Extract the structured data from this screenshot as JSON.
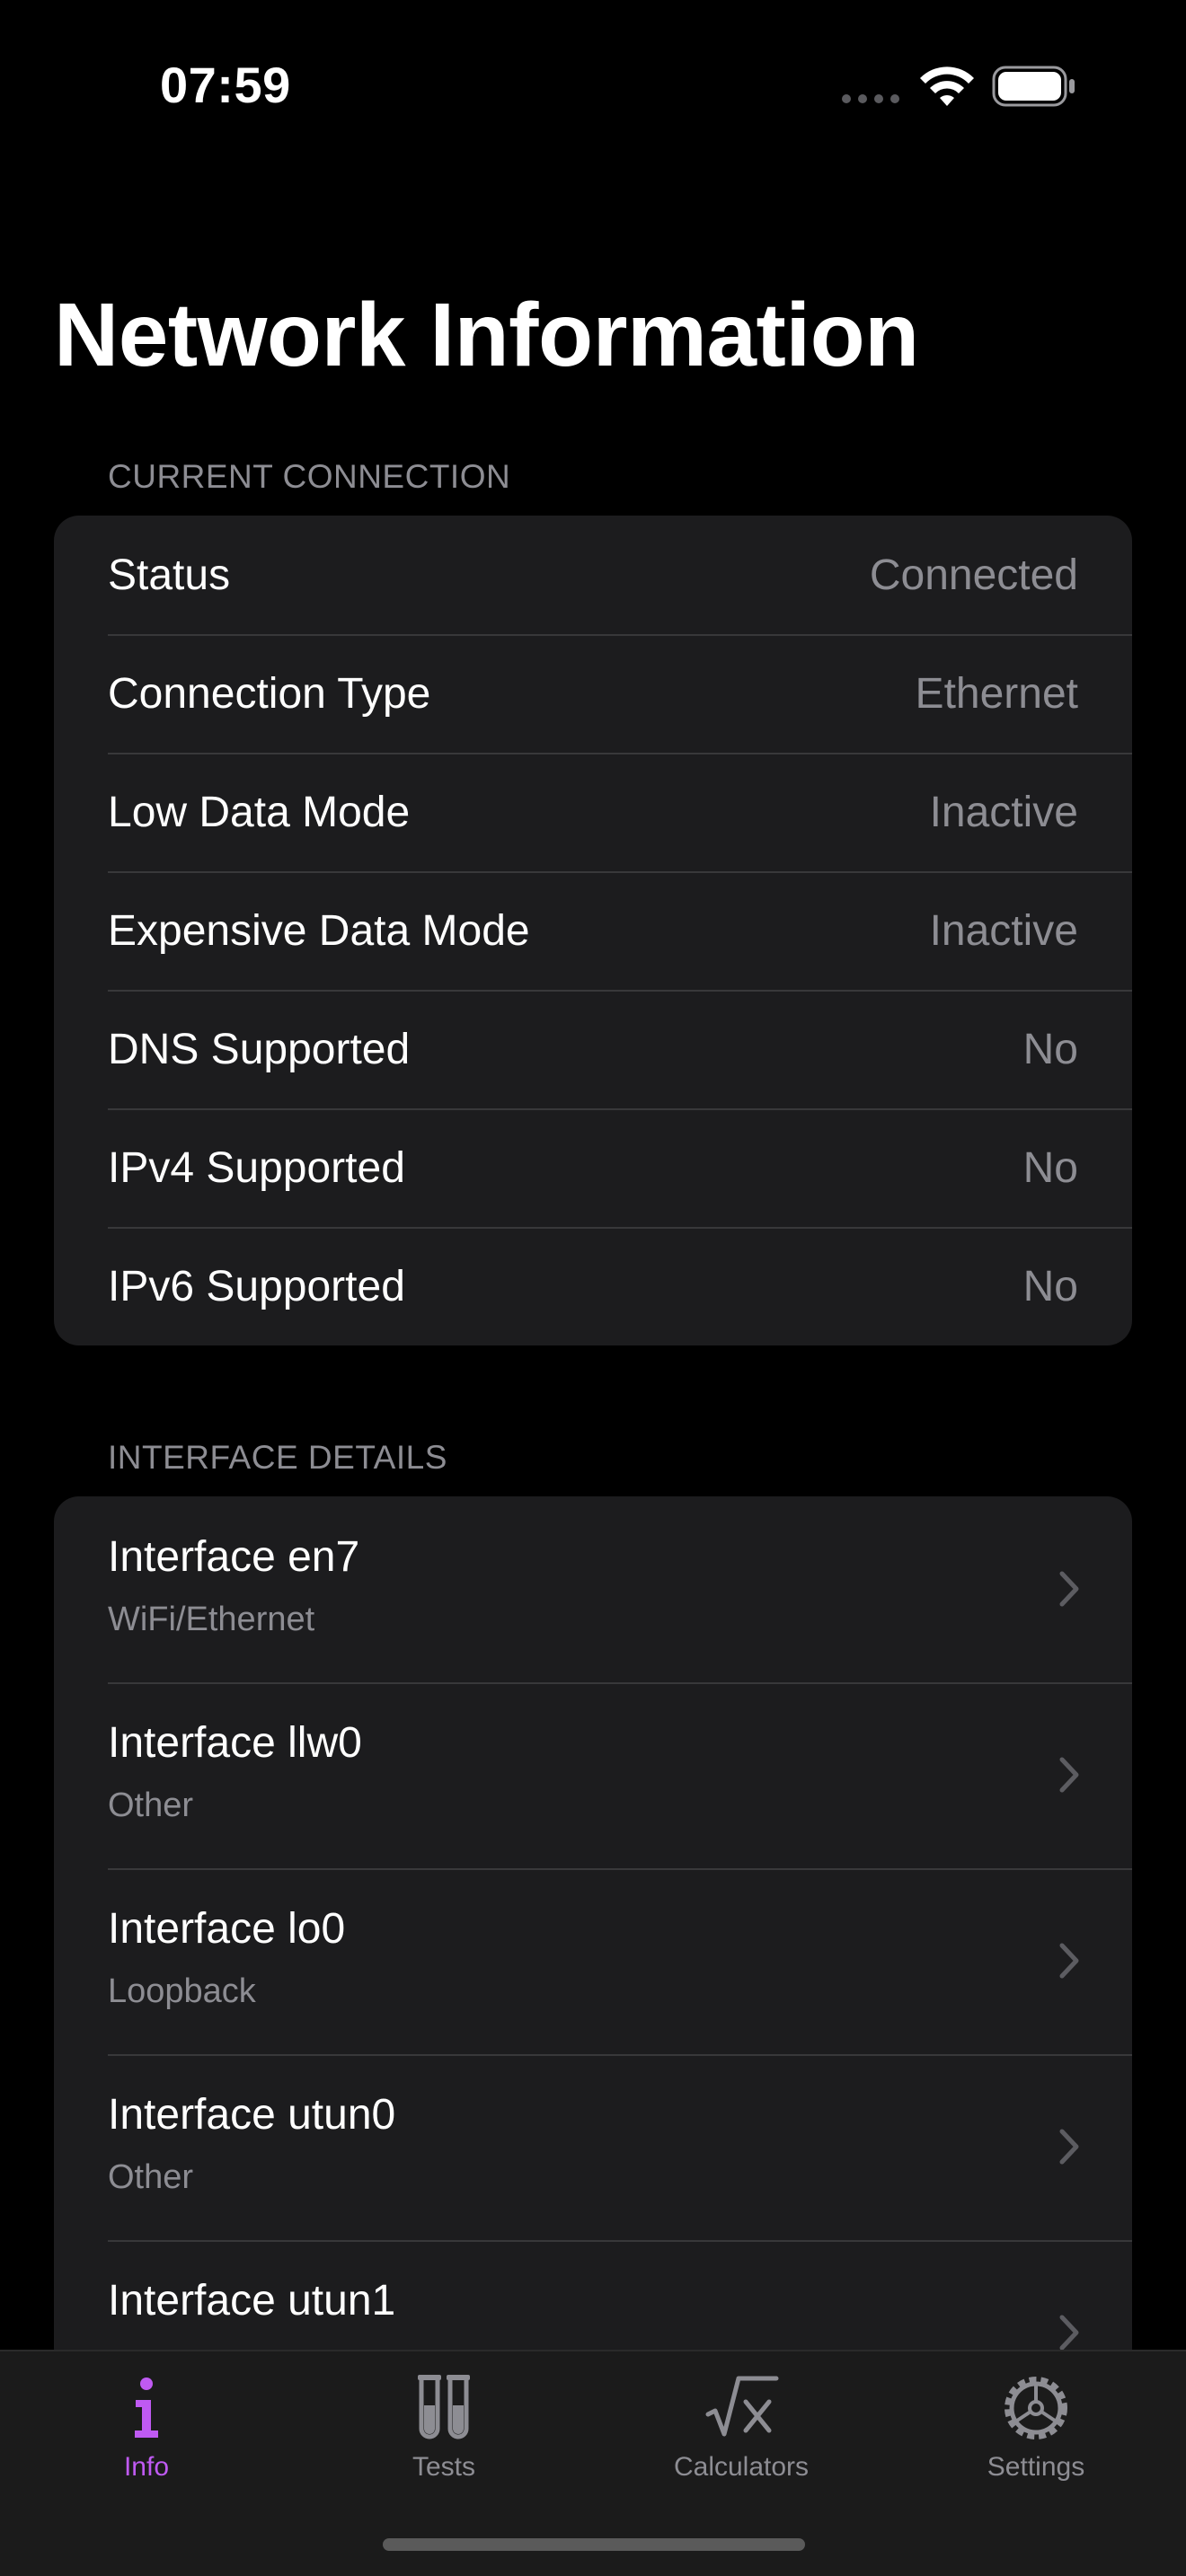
{
  "status_bar": {
    "time": "07:59"
  },
  "page": {
    "title": "Network Information"
  },
  "current_connection": {
    "header": "CURRENT CONNECTION",
    "rows": [
      {
        "label": "Status",
        "value": "Connected"
      },
      {
        "label": "Connection Type",
        "value": "Ethernet"
      },
      {
        "label": "Low Data Mode",
        "value": "Inactive"
      },
      {
        "label": "Expensive Data Mode",
        "value": "Inactive"
      },
      {
        "label": "DNS Supported",
        "value": "No"
      },
      {
        "label": "IPv4 Supported",
        "value": "No"
      },
      {
        "label": "IPv6 Supported",
        "value": "No"
      }
    ]
  },
  "interface_details": {
    "header": "INTERFACE DETAILS",
    "items": [
      {
        "title": "Interface en7",
        "subtitle": "WiFi/Ethernet"
      },
      {
        "title": "Interface llw0",
        "subtitle": "Other"
      },
      {
        "title": "Interface lo0",
        "subtitle": "Loopback"
      },
      {
        "title": "Interface utun0",
        "subtitle": "Other"
      },
      {
        "title": "Interface utun1",
        "subtitle": ""
      }
    ]
  },
  "tab_bar": {
    "tabs": [
      {
        "label": "Info",
        "icon": "info-icon",
        "active": true
      },
      {
        "label": "Tests",
        "icon": "test-tubes-icon",
        "active": false
      },
      {
        "label": "Calculators",
        "icon": "square-root-icon",
        "active": false
      },
      {
        "label": "Settings",
        "icon": "gear-icon",
        "active": false
      }
    ]
  },
  "colors": {
    "background": "#000000",
    "group_background": "#1c1c1e",
    "secondary_text": "#8d8d93",
    "accent": "#bf5af2",
    "separator": "#38383a"
  }
}
